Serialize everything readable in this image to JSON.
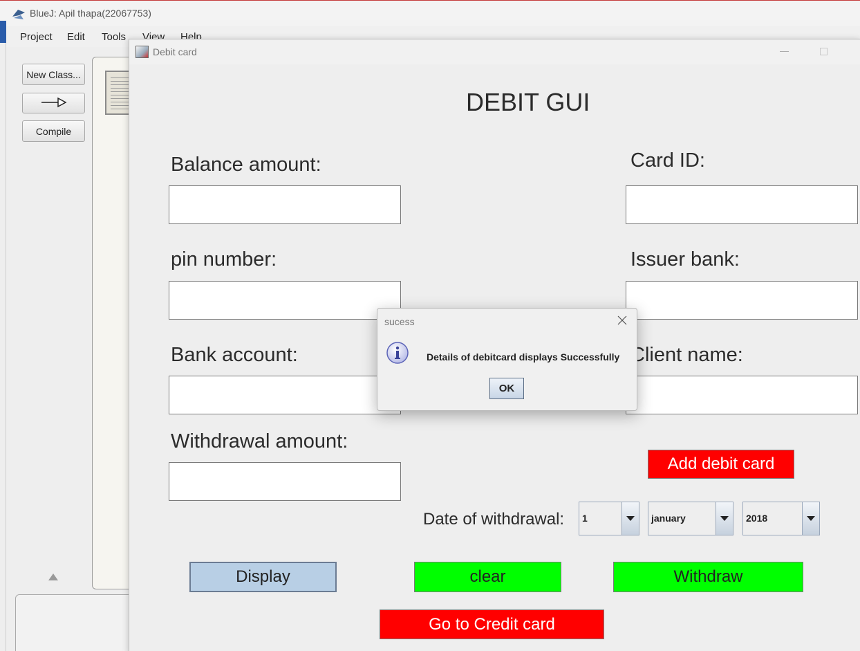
{
  "bluej": {
    "title": "BlueJ:  Apil thapa(22067753)",
    "menu": [
      "Project",
      "Edit",
      "Tools",
      "View",
      "Help"
    ],
    "buttons": {
      "new_class": "New Class...",
      "compile": "Compile"
    }
  },
  "debit_window": {
    "title": "Debit card",
    "heading": "DEBIT GUI",
    "labels": {
      "balance_amount": "Balance amount:",
      "pin_number": "pin number:",
      "bank_account": "Bank account:",
      "withdrawal_amount": "Withdrawal amount:",
      "card_id": "Card ID:",
      "issuer_bank": "Issuer bank:",
      "client_name": "Client name:",
      "date_of_withdrawal": "Date of withdrawal:"
    },
    "fields": {
      "balance_amount": "",
      "pin_number": "",
      "bank_account": "",
      "withdrawal_amount": "",
      "card_id": "",
      "issuer_bank": "",
      "client_name": ""
    },
    "date": {
      "day": "1",
      "month": "january",
      "year": "2018"
    },
    "buttons": {
      "add_debit_card": "Add debit card",
      "display": "Display",
      "clear": "clear",
      "withdraw": "Withdraw",
      "go_to_credit": "Go to Credit card"
    },
    "colors": {
      "red": "#ff0000",
      "green": "#00ff00",
      "display_blue": "#b8cfe5"
    }
  },
  "dialog": {
    "title": "sucess",
    "message": "Details of debitcard displays Successfully",
    "ok": "OK",
    "icon": "info-icon"
  }
}
